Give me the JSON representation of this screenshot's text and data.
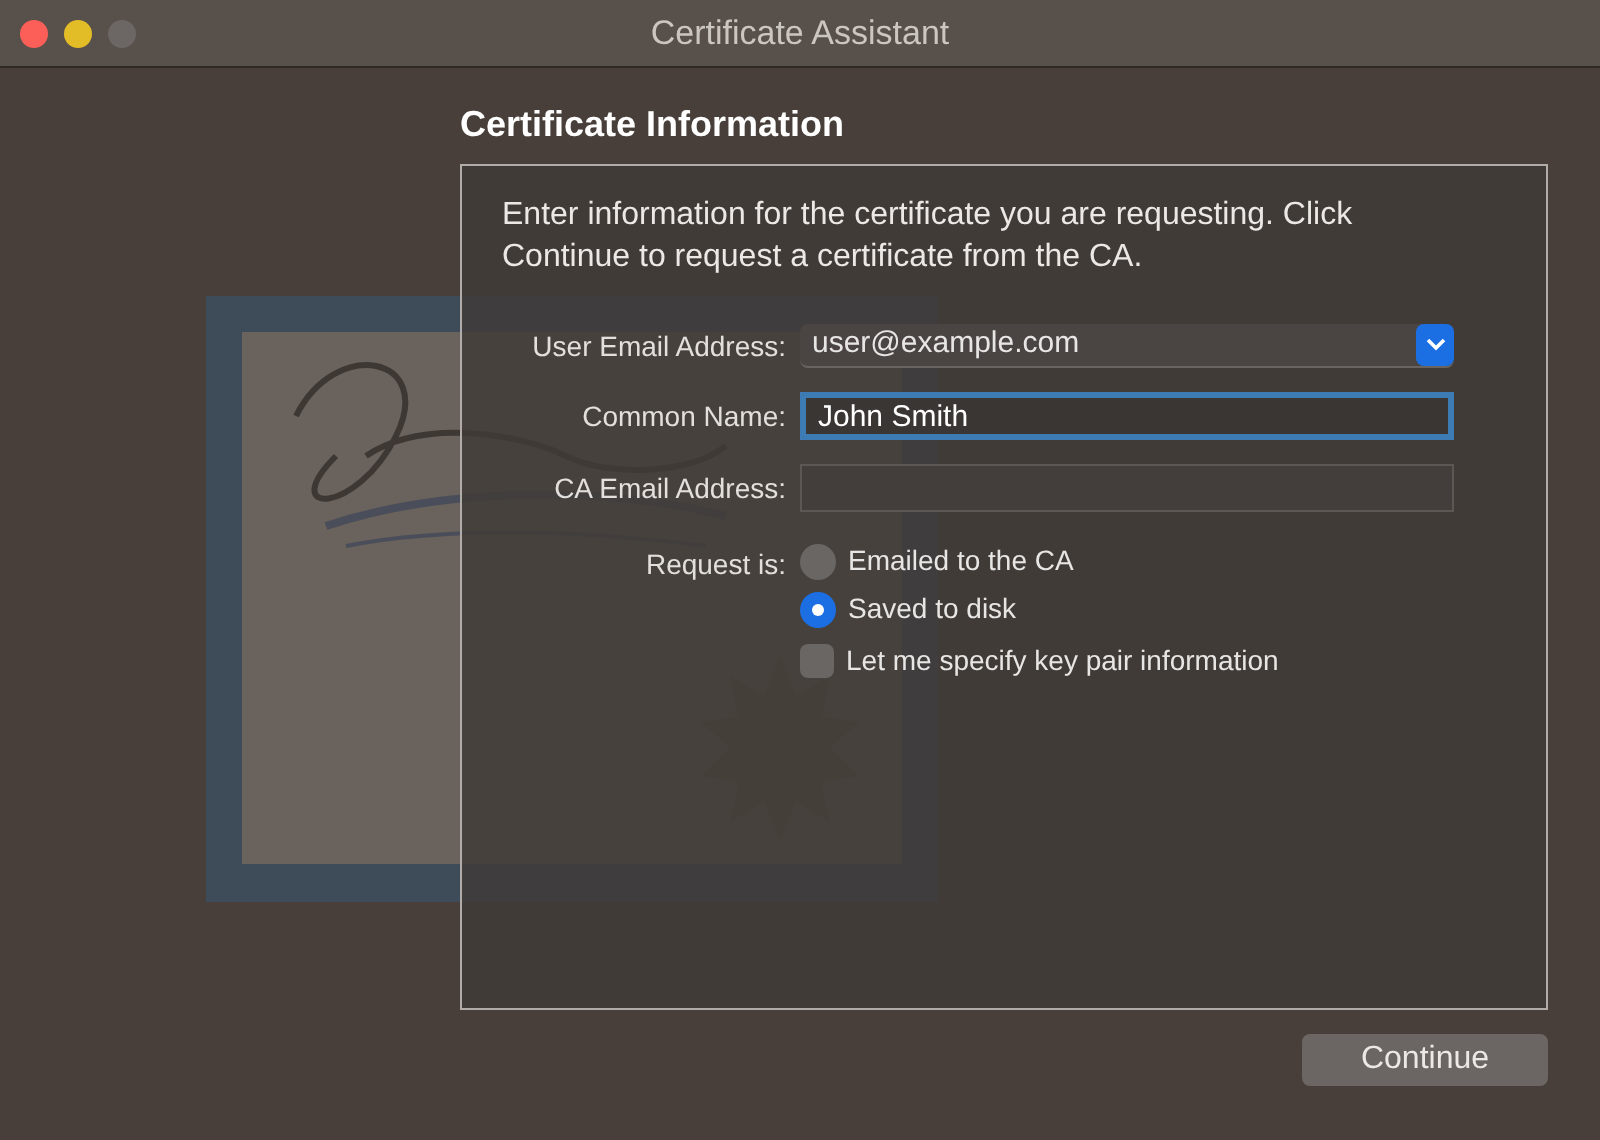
{
  "window": {
    "title": "Certificate Assistant"
  },
  "heading": "Certificate Information",
  "intro": "Enter information for the certificate you are requesting. Click Continue to request a certificate from the CA.",
  "fields": [
    {
      "label": "User Email Address:",
      "kind": "dropdown",
      "value": "user@example.com"
    },
    {
      "label": "Common Name:",
      "kind": "text",
      "value": "John Smith",
      "focused": true
    },
    {
      "label": "CA Email Address:",
      "kind": "text",
      "focused": false
    }
  ],
  "request": {
    "label": "Request is:",
    "options": [
      {
        "label": "Emailed to the CA",
        "selected": false
      },
      {
        "label": "Saved to disk",
        "selected": true
      }
    ]
  },
  "key_pair": {
    "label": "Let me specify key pair information",
    "checked": false
  },
  "buttons": [
    "Continue"
  ]
}
